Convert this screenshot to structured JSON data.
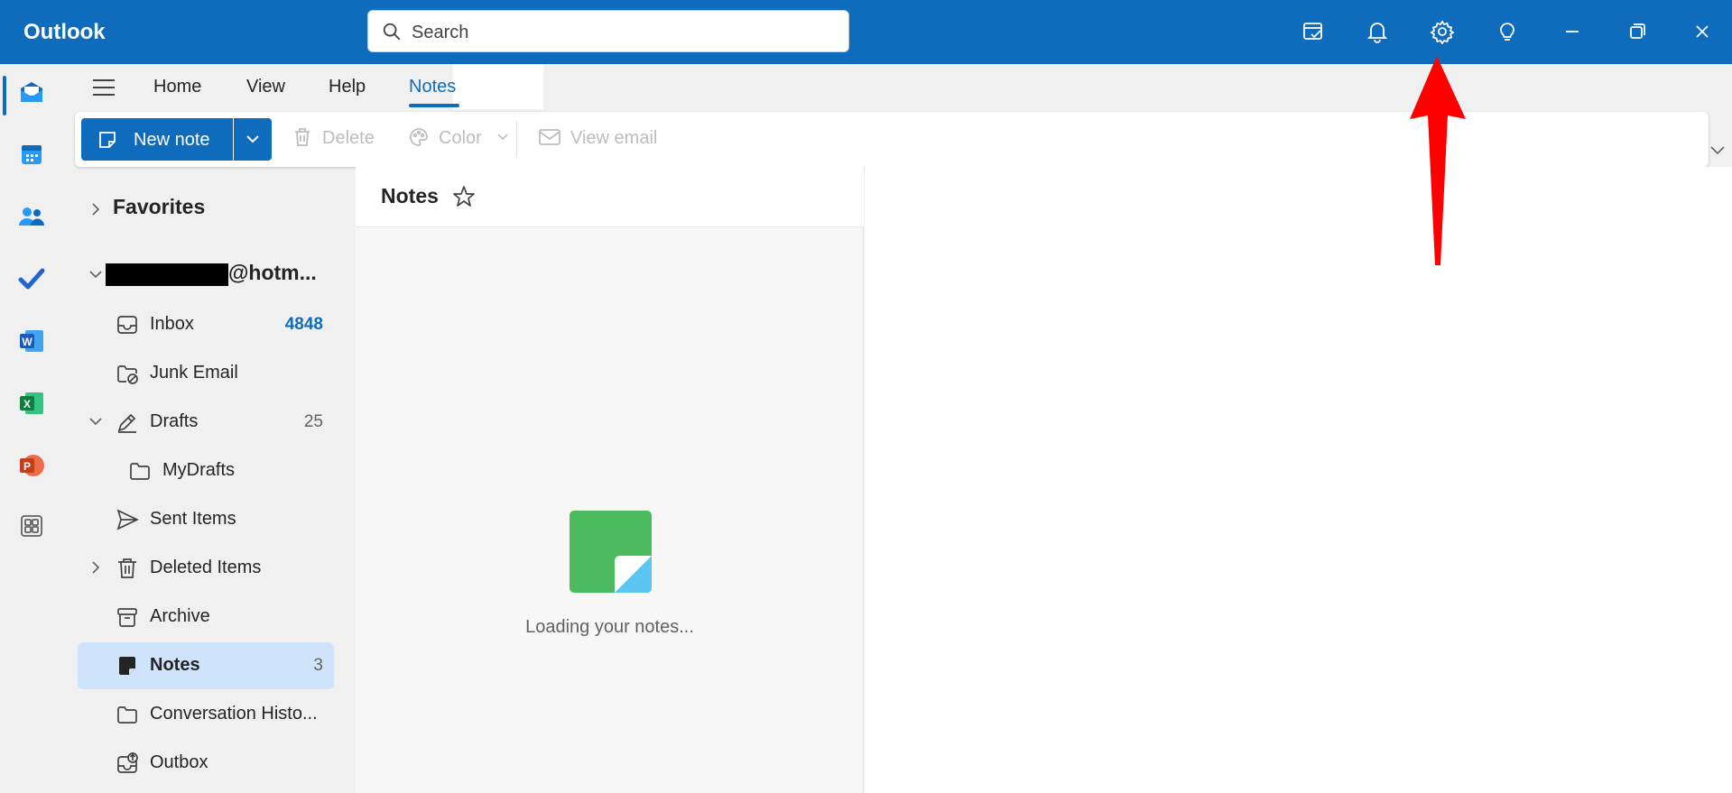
{
  "titlebar": {
    "app_title": "Outlook",
    "search_placeholder": "Search",
    "icons": [
      "my-day-icon",
      "bell-icon",
      "gear-icon",
      "lightbulb-icon",
      "minimize-icon",
      "restore-icon",
      "close-icon"
    ]
  },
  "rail": {
    "items": [
      "mail-icon",
      "calendar-icon",
      "people-icon",
      "todo-icon",
      "word-icon",
      "excel-icon",
      "powerpoint-icon",
      "apps-icon"
    ]
  },
  "tabs": [
    {
      "label": "Home"
    },
    {
      "label": "View"
    },
    {
      "label": "Help"
    },
    {
      "label": "Notes",
      "active": true
    }
  ],
  "ribbon": {
    "new_note": "New note",
    "delete": "Delete",
    "color": "Color",
    "view_email": "View email"
  },
  "folders": {
    "favorites": "Favorites",
    "account": "@hotm...",
    "items": [
      {
        "label": "Inbox",
        "count": "4848"
      },
      {
        "label": "Junk Email",
        "count": ""
      },
      {
        "label": "Drafts",
        "count": "25"
      },
      {
        "label": "MyDrafts",
        "count": ""
      },
      {
        "label": "Sent Items",
        "count": ""
      },
      {
        "label": "Deleted Items",
        "count": ""
      },
      {
        "label": "Archive",
        "count": ""
      },
      {
        "label": "Notes",
        "count": "3"
      },
      {
        "label": "Conversation Histo...",
        "count": ""
      },
      {
        "label": "Outbox",
        "count": ""
      }
    ]
  },
  "notes_pane": {
    "title": "Notes",
    "loading": "Loading your notes..."
  },
  "colors": {
    "brand": "#0f6cbd",
    "selected": "#cfe4fa",
    "annotation_arrow": "#ff0000"
  }
}
